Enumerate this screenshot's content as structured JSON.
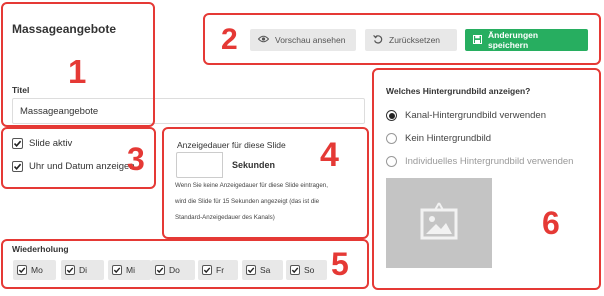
{
  "page": {
    "title": "Massageangebote"
  },
  "toolbar": {
    "preview_label": "Vorschau ansehen",
    "reset_label": "Zurücksetzen",
    "save_label": "Änderungen speichern",
    "save_color": "#27ae60"
  },
  "title_field": {
    "label": "Titel",
    "value": "Massageangebote"
  },
  "options": {
    "slide_active": "Slide aktiv",
    "show_datetime": "Uhr und Datum anzeigen"
  },
  "duration": {
    "label": "Anzeigedauer für diese Slide",
    "value": "",
    "unit": "Sekunden",
    "help_line1": "Wenn Sie keine Anzeigedauer für diese Slide eintragen,",
    "help_line2": "wird die Slide für 15 Sekunden angezeigt (das ist die",
    "help_line3": "Standard-Anzeigedauer des Kanals)"
  },
  "repeat": {
    "label": "Wiederholung",
    "days": [
      "Mo",
      "Di",
      "Mi",
      "Do",
      "Fr",
      "Sa",
      "So"
    ]
  },
  "background": {
    "question": "Welches Hintergrundbild anzeigen?",
    "options": [
      "Kanal-Hintergrundbild verwenden",
      "Kein Hintergrundbild",
      "Individuelles Hintergrundbild verwenden"
    ],
    "selected": "Kanal-Hintergrundbild verwenden"
  },
  "annotations": {
    "color": "#e53935",
    "labels": [
      "1",
      "2",
      "3",
      "4",
      "5",
      "6"
    ]
  },
  "icons": [
    "eye-icon",
    "undo-icon",
    "save-icon",
    "check-icon",
    "image-placeholder-icon"
  ]
}
